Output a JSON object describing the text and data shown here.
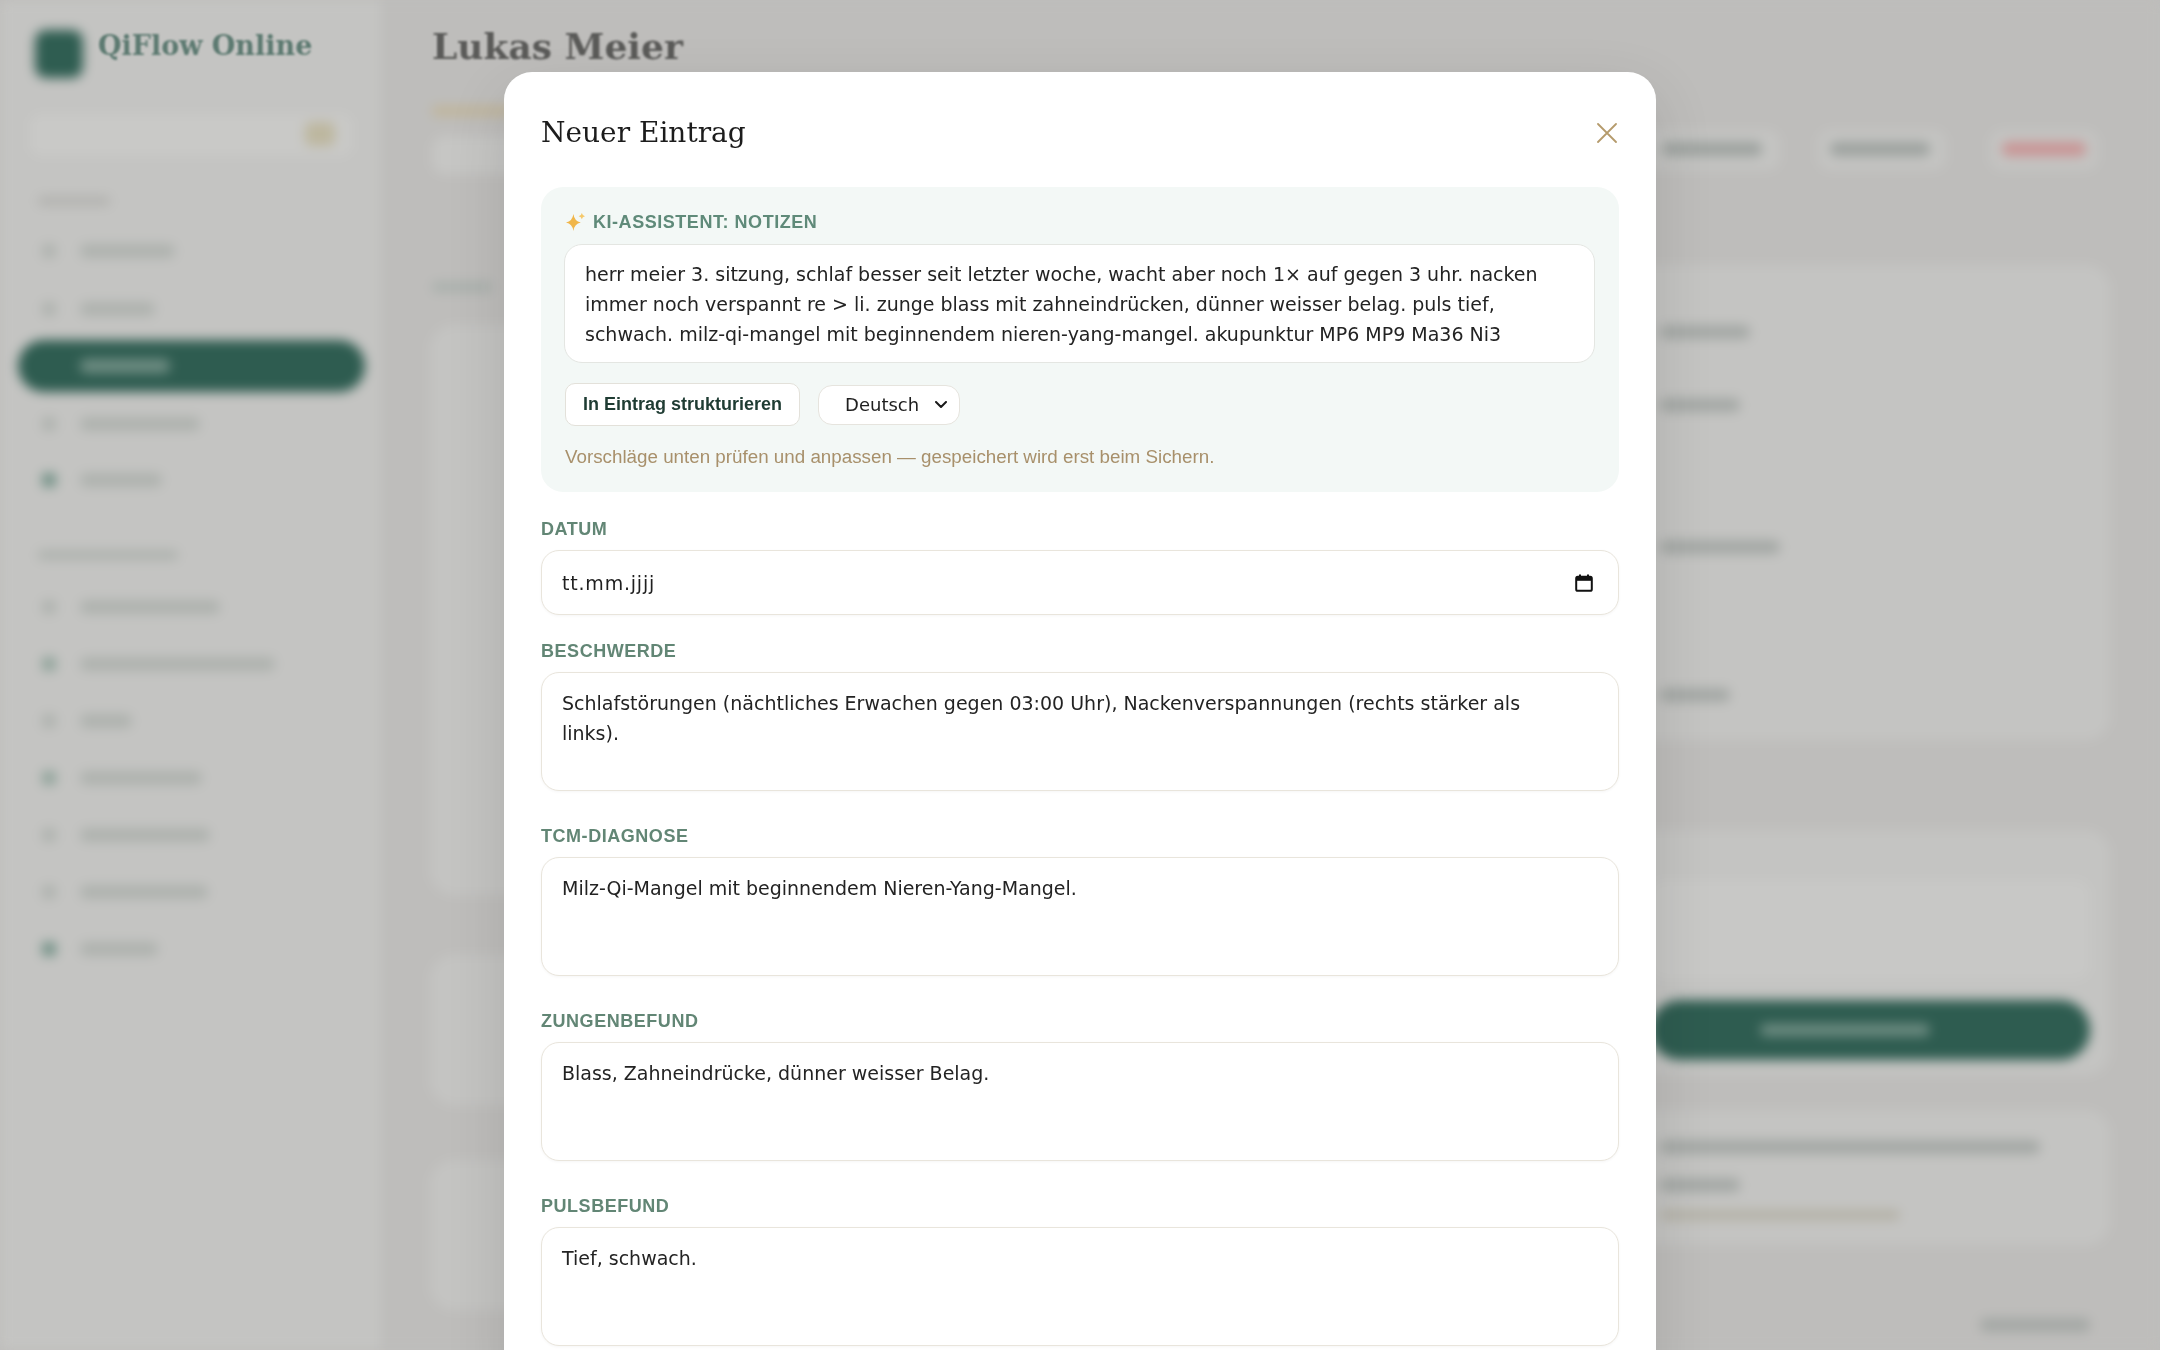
{
  "app_background": {
    "logo_text": "QiFlow Online",
    "page_title": "Lukas Meier"
  },
  "dialog": {
    "title": "Neuer Eintrag",
    "ai_assistant": {
      "label": "KI-ASSISTENT: NOTIZEN",
      "notes": "herr meier 3. sitzung, schlaf besser seit letzter woche, wacht aber noch 1× auf gegen 3 uhr. nacken immer noch verspannt re > li. zunge blass mit zahneindrücken, dünner weisser belag. puls tief, schwach. milz-qi-mangel mit beginnendem nieren-yang-mangel. akupunktur MP6 MP9 Ma36 Ni3",
      "structure_button": "In Eintrag strukturieren",
      "language_select": {
        "value": "Deutsch"
      },
      "hint": "Vorschläge unten prüfen und anpassen — gespeichert wird erst beim Sichern."
    },
    "fields": [
      {
        "kind": "date",
        "label": "DATUM",
        "placeholder": "tt.mm.jjjj"
      },
      {
        "kind": "textarea",
        "label": "BESCHWERDE",
        "value": "Schlafstörungen (nächtliches Erwachen gegen 03:00 Uhr), Nackenverspannungen (rechts stärker als links)."
      },
      {
        "kind": "textarea",
        "label": "TCM-DIAGNOSE",
        "value": "Milz-Qi-Mangel mit beginnendem Nieren-Yang-Mangel."
      },
      {
        "kind": "textarea",
        "label": "ZUNGENBEFUND",
        "value": "Blass, Zahneindrücke, dünner weisser Belag."
      },
      {
        "kind": "textarea",
        "label": "PULSBEFUND",
        "value": "Tief, schwach."
      }
    ]
  }
}
